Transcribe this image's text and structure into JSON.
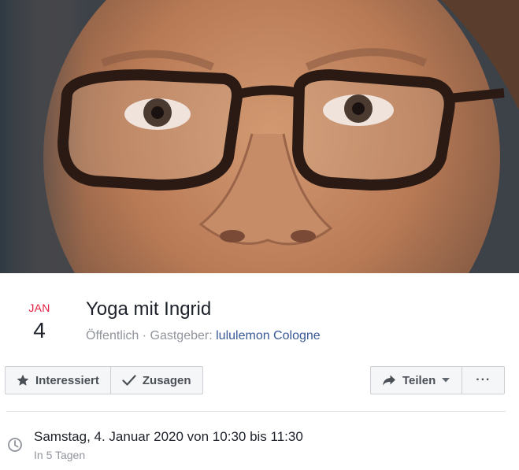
{
  "cover": {
    "description_icon": "cover-photo"
  },
  "event": {
    "month": "JAN",
    "day": "4",
    "title": "Yoga mit Ingrid",
    "privacy": "Öffentlich",
    "separator": " · ",
    "host_label": "Gastgeber: ",
    "host_name": "lululemon Cologne"
  },
  "actions": {
    "interested_label": "Interessiert",
    "interested_icon": "star-icon",
    "going_label": "Zusagen",
    "going_icon": "checkmark-icon",
    "share_label": "Teilen",
    "share_icon": "share-arrow-icon",
    "more_label": "···"
  },
  "details": {
    "datetime": "Samstag, 4. Januar 2020 von 10:30 bis 11:30",
    "relative": "In 5 Tagen",
    "clock_icon": "clock-icon"
  },
  "colors": {
    "month_red": "#e41e3f",
    "link_blue": "#385898",
    "meta_gray": "#90949c",
    "button_bg": "#f5f6f7"
  }
}
